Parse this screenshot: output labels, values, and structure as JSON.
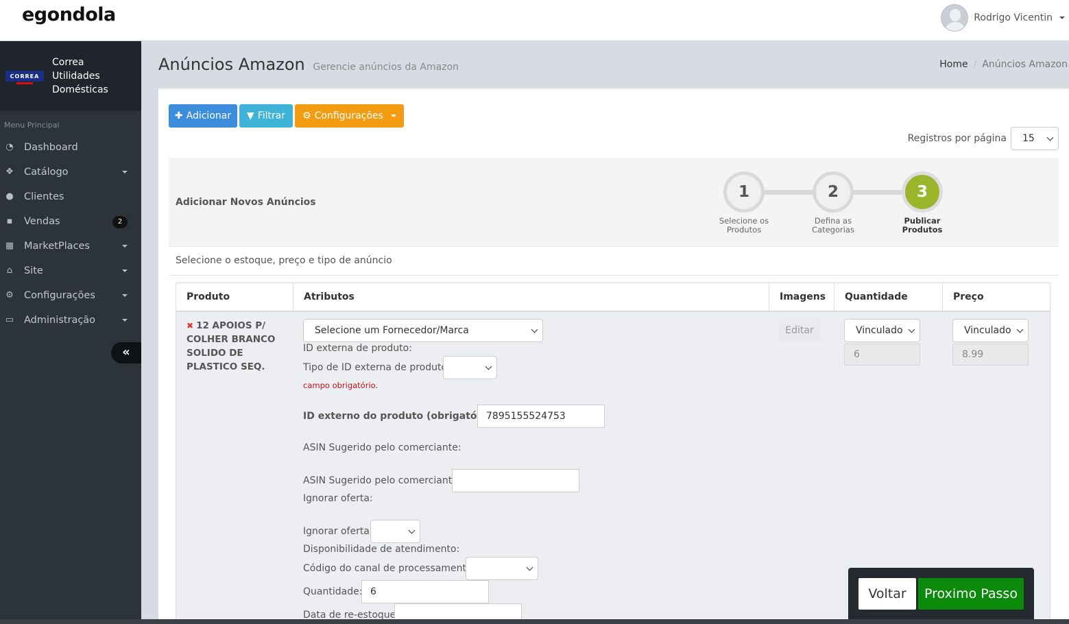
{
  "header": {
    "logo": "egondola",
    "user_name": "Rodrigo Vicentin"
  },
  "sidebar": {
    "brand_logo_text": "CORREA",
    "brand_name": "Correa Utilidades Domésticas",
    "menu_header": "Menu Principal",
    "items": [
      {
        "label": "Dashboard",
        "icon": "dashboard-icon"
      },
      {
        "label": "Catálogo",
        "icon": "cubes-icon"
      },
      {
        "label": "Clientes",
        "icon": "users-icon"
      },
      {
        "label": "Vendas",
        "icon": "cart-icon",
        "badge": "2"
      },
      {
        "label": "MarketPlaces",
        "icon": "grid-icon"
      },
      {
        "label": "Site",
        "icon": "bank-icon"
      },
      {
        "label": "Configurações",
        "icon": "cogs-icon"
      },
      {
        "label": "Administração",
        "icon": "laptop-icon"
      }
    ],
    "collapse_symbol": "«"
  },
  "page": {
    "title": "Anúncios Amazon",
    "subtitle": "Gerencie anúncios da Amazon",
    "breadcrumb": [
      "Home",
      "Anúncios Amazon"
    ]
  },
  "toolbar": {
    "add_label": "Adicionar",
    "filter_label": "Filtrar",
    "config_label": "Configurações",
    "per_page_label": "Registros por página",
    "per_page_value": "15"
  },
  "wizard": {
    "title": "Adicionar Novos Anúncios",
    "steps": [
      {
        "number": "1",
        "label_line1": "Selecione os",
        "label_line2": "Produtos"
      },
      {
        "number": "2",
        "label_line1": "Defina as",
        "label_line2": "Categorias"
      },
      {
        "number": "3",
        "label_line1": "Publicar",
        "label_line2": "Produtos"
      }
    ],
    "active_step": 3
  },
  "section": {
    "subtitle": "Selecione o estoque, preço e tipo de anúncio"
  },
  "table": {
    "columns": [
      "Produto",
      "Atributos",
      "Imagens",
      "Quantidade",
      "Preço"
    ],
    "row": {
      "product_name": "12 APOIOS P/ COLHER BRANCO SOLIDO DE PLASTICO SEQ.",
      "supplier_select": "Selecione um Fornecedor/Marca",
      "ext_id_label": "ID externa de produto:",
      "ext_id_type_label": "Tipo de ID externa de produto:",
      "required_msg": "campo obrigatório.",
      "ext_id_required_label": "ID externo do produto (obrigatório):",
      "ext_id_value": "7895155524753",
      "asin_heading": "ASIN Sugerido pelo comerciante:",
      "asin_label": "ASIN Sugerido pelo comerciante:",
      "ignore_heading": "Ignorar oferta:",
      "ignore_label": "Ignorar oferta:",
      "availability_label": "Disponibilidade de atendimento:",
      "channel_label": "Código do canal de processamento:",
      "quantity_label": "Quantidade:",
      "quantity_value": "6",
      "restock_label": "Data de re-estoque:",
      "edit_label": "Editar",
      "qty_select": "Vinculado",
      "qty_value": "6",
      "price_select": "Vinculado",
      "price_value": "8.99"
    }
  },
  "footer": {
    "back_label": "Voltar",
    "next_label": "Proximo Passo"
  }
}
